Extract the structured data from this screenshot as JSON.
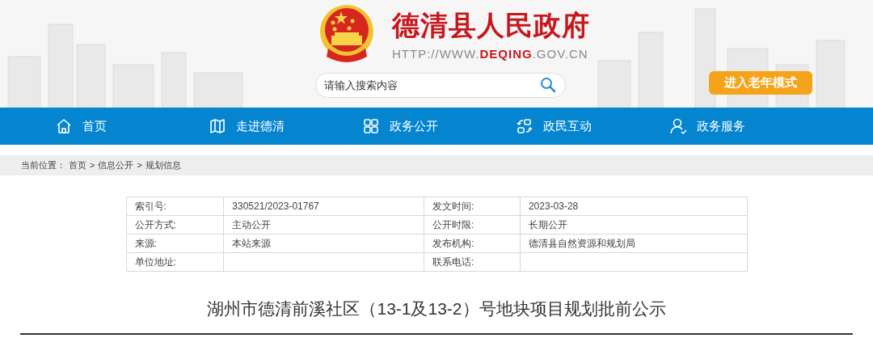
{
  "header": {
    "site_title": "德清县人民政府",
    "url_prefix": "HTTP://WWW.",
    "url_domain": "DEQING",
    "url_suffix": ".GOV.CN",
    "search": {
      "placeholder": "请输入搜索内容"
    },
    "elder_mode_button": "进入老年模式"
  },
  "nav": [
    {
      "label": "首页",
      "kind": "home"
    },
    {
      "label": "走进德清",
      "kind": "map"
    },
    {
      "label": "政务公开",
      "kind": "grid"
    },
    {
      "label": "政民互动",
      "kind": "exchange"
    },
    {
      "label": "政务服务",
      "kind": "user"
    }
  ],
  "breadcrumb": {
    "label": "当前位置：",
    "items": [
      "首页",
      "信息公开",
      "规划信息"
    ],
    "separator": ">"
  },
  "info_table": [
    [
      {
        "label": "索引号:",
        "value": "330521/2023-01767"
      },
      {
        "label": "发文时间:",
        "value": "2023-03-28"
      }
    ],
    [
      {
        "label": "公开方式:",
        "value": "主动公开"
      },
      {
        "label": "公开时限:",
        "value": "长期公开"
      }
    ],
    [
      {
        "label": "来源:",
        "value": "本站来源"
      },
      {
        "label": "发布机构:",
        "value": "德清县自然资源和规划局"
      }
    ],
    [
      {
        "label": "单位地址:"
      },
      {
        "label": "联系电话:"
      }
    ]
  ],
  "article_title": "湖州市德清前溪社区（13-1及13-2）号地块项目规划批前公示"
}
